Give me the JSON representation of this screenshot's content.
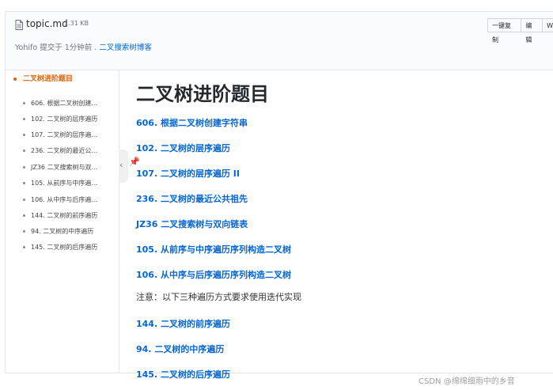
{
  "file": {
    "name": "topic.md",
    "size": "1.31 KB",
    "icon": "file-icon"
  },
  "toolbar": {
    "copy_label": "一键复制",
    "edit_label": "编辑",
    "extra_label": "W"
  },
  "commit": {
    "text": "Yohifo 提交于 1分钟前 . ",
    "link": "二叉搜索树博客"
  },
  "toc": {
    "main": "二叉树进阶题目",
    "items": [
      "606. 根据二叉树创建...",
      "102. 二叉树的层序遍历",
      "107. 二叉树的层序遍...",
      "236. 二叉树的最近公...",
      "JZ36 二叉搜索树与双...",
      "105. 从前序与中序遍...",
      "106. 从中序与后序遍...",
      "144. 二叉树的前序遍历",
      "94. 二叉树的中序遍历",
      "145. 二叉树的后序遍历"
    ]
  },
  "content": {
    "title": "二叉树进阶题目",
    "links_a": [
      "606. 根据二叉树创建字符串",
      "102. 二叉树的层序遍历",
      "107. 二叉树的层序遍历 II",
      "236. 二叉树的最近公共祖先",
      "JZ36 二叉搜索树与双向链表",
      "105. 从前序与中序遍历序列构造二叉树",
      "106. 从中序与后序遍历序列构造二叉树"
    ],
    "note": "注意：以下三种遍历方式要求使用迭代实现",
    "links_b": [
      "144. 二叉树的前序遍历",
      "94. 二叉树的中序遍历",
      "145. 二叉树的后序遍历"
    ]
  },
  "watermark": "CSDN @绵绵细雨中的乡音"
}
